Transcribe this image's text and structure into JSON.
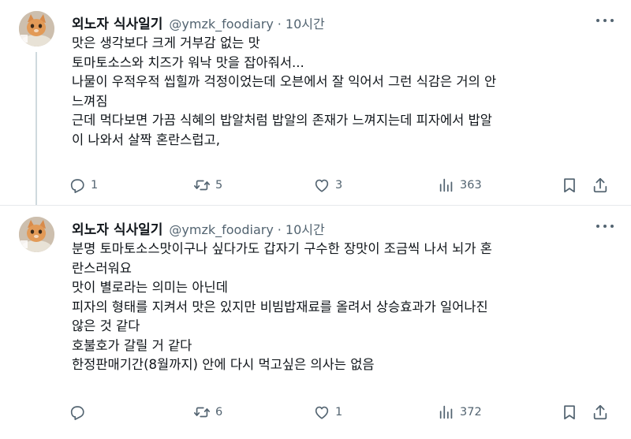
{
  "tweets": [
    {
      "author_name": "외노자 식사일기",
      "handle": "@ymzk_foodiary",
      "separator": "·",
      "time": "10시간",
      "lines": [
        "맛은 생각보다 크게 거부감 없는 맛",
        "토마토소스와 치즈가 워낙 맛을 잡아줘서...",
        "나물이 우적우적 씹힐까 걱정이었는데 오븐에서 잘 익어서 그런 식감은 거의 안",
        "느껴짐",
        "근데 먹다보면 가끔 식혜의 밥알처럼 밥알의 존재가 느껴지는데 피자에서 밥알",
        "이 나와서 살짝 혼란스럽고,"
      ],
      "replies": "1",
      "reposts": "5",
      "likes": "3",
      "views": "363"
    },
    {
      "author_name": "외노자 식사일기",
      "handle": "@ymzk_foodiary",
      "separator": "·",
      "time": "10시간",
      "lines": [
        "분명 토마토소스맛이구나 싶다가도 갑자기 구수한 장맛이 조금씩 나서 뇌가 혼",
        "란스러워요",
        "맛이 별로라는 의미는 아닌데",
        "피자의 형태를 지켜서 맛은 있지만 비빔밥재료를 올려서 상승효과가 일어나진",
        "않은 것 같다",
        "호불호가 갈릴 거 같다",
        "한정판매기간(8월까지) 안에 다시 먹고싶은 의사는 없음"
      ],
      "replies": "",
      "reposts": "6",
      "likes": "1",
      "views": "372"
    }
  ],
  "icons": {
    "reply": "reply-icon",
    "repost": "repost-icon",
    "like": "heart-icon",
    "views": "views-icon",
    "bookmark": "bookmark-icon",
    "share": "share-icon",
    "more": "more-icon"
  },
  "colors": {
    "text": "#0f1419",
    "muted": "#536471",
    "divider": "#e6e9ec",
    "thread_line": "#cfd9de"
  }
}
